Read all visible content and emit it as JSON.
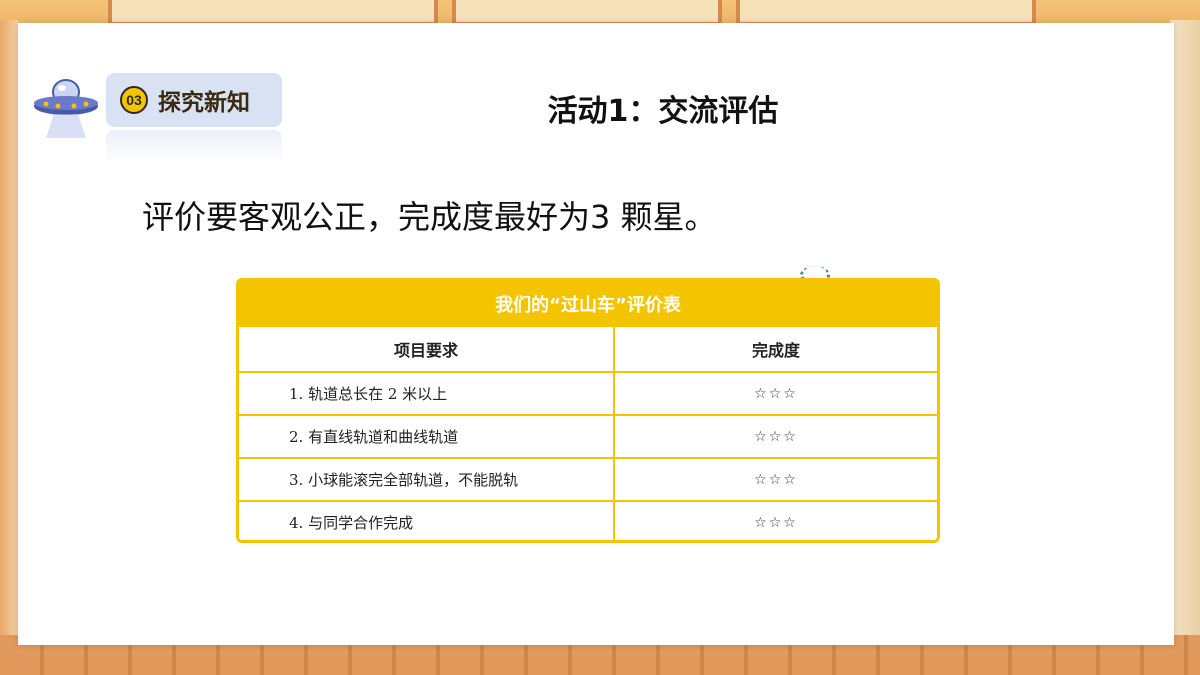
{
  "section": {
    "number": "03",
    "label": "探究新知"
  },
  "slide_title": "活动1：交流评估",
  "instruction": "评价要客观公正，完成度最好为3 颗星。",
  "evaluation_table": {
    "title": "我们的“过山车”评价表",
    "headers": [
      "项目要求",
      "完成度"
    ],
    "rows": [
      {
        "requirement": "1. 轨道总长在 2 米以上",
        "rating": "☆☆☆"
      },
      {
        "requirement": "2. 有直线轨道和曲线轨道",
        "rating": "☆☆☆"
      },
      {
        "requirement": "3. 小球能滚完全部轨道，不能脱轨",
        "rating": "☆☆☆"
      },
      {
        "requirement": "4. 与同学合作完成",
        "rating": "☆☆☆"
      }
    ]
  },
  "colors": {
    "accent_yellow": "#f5c400",
    "badge_bg": "#d9e2f3",
    "ufo_purple": "#4a5aa8"
  },
  "icons": [
    "ufo-icon",
    "sparkle-icon"
  ]
}
